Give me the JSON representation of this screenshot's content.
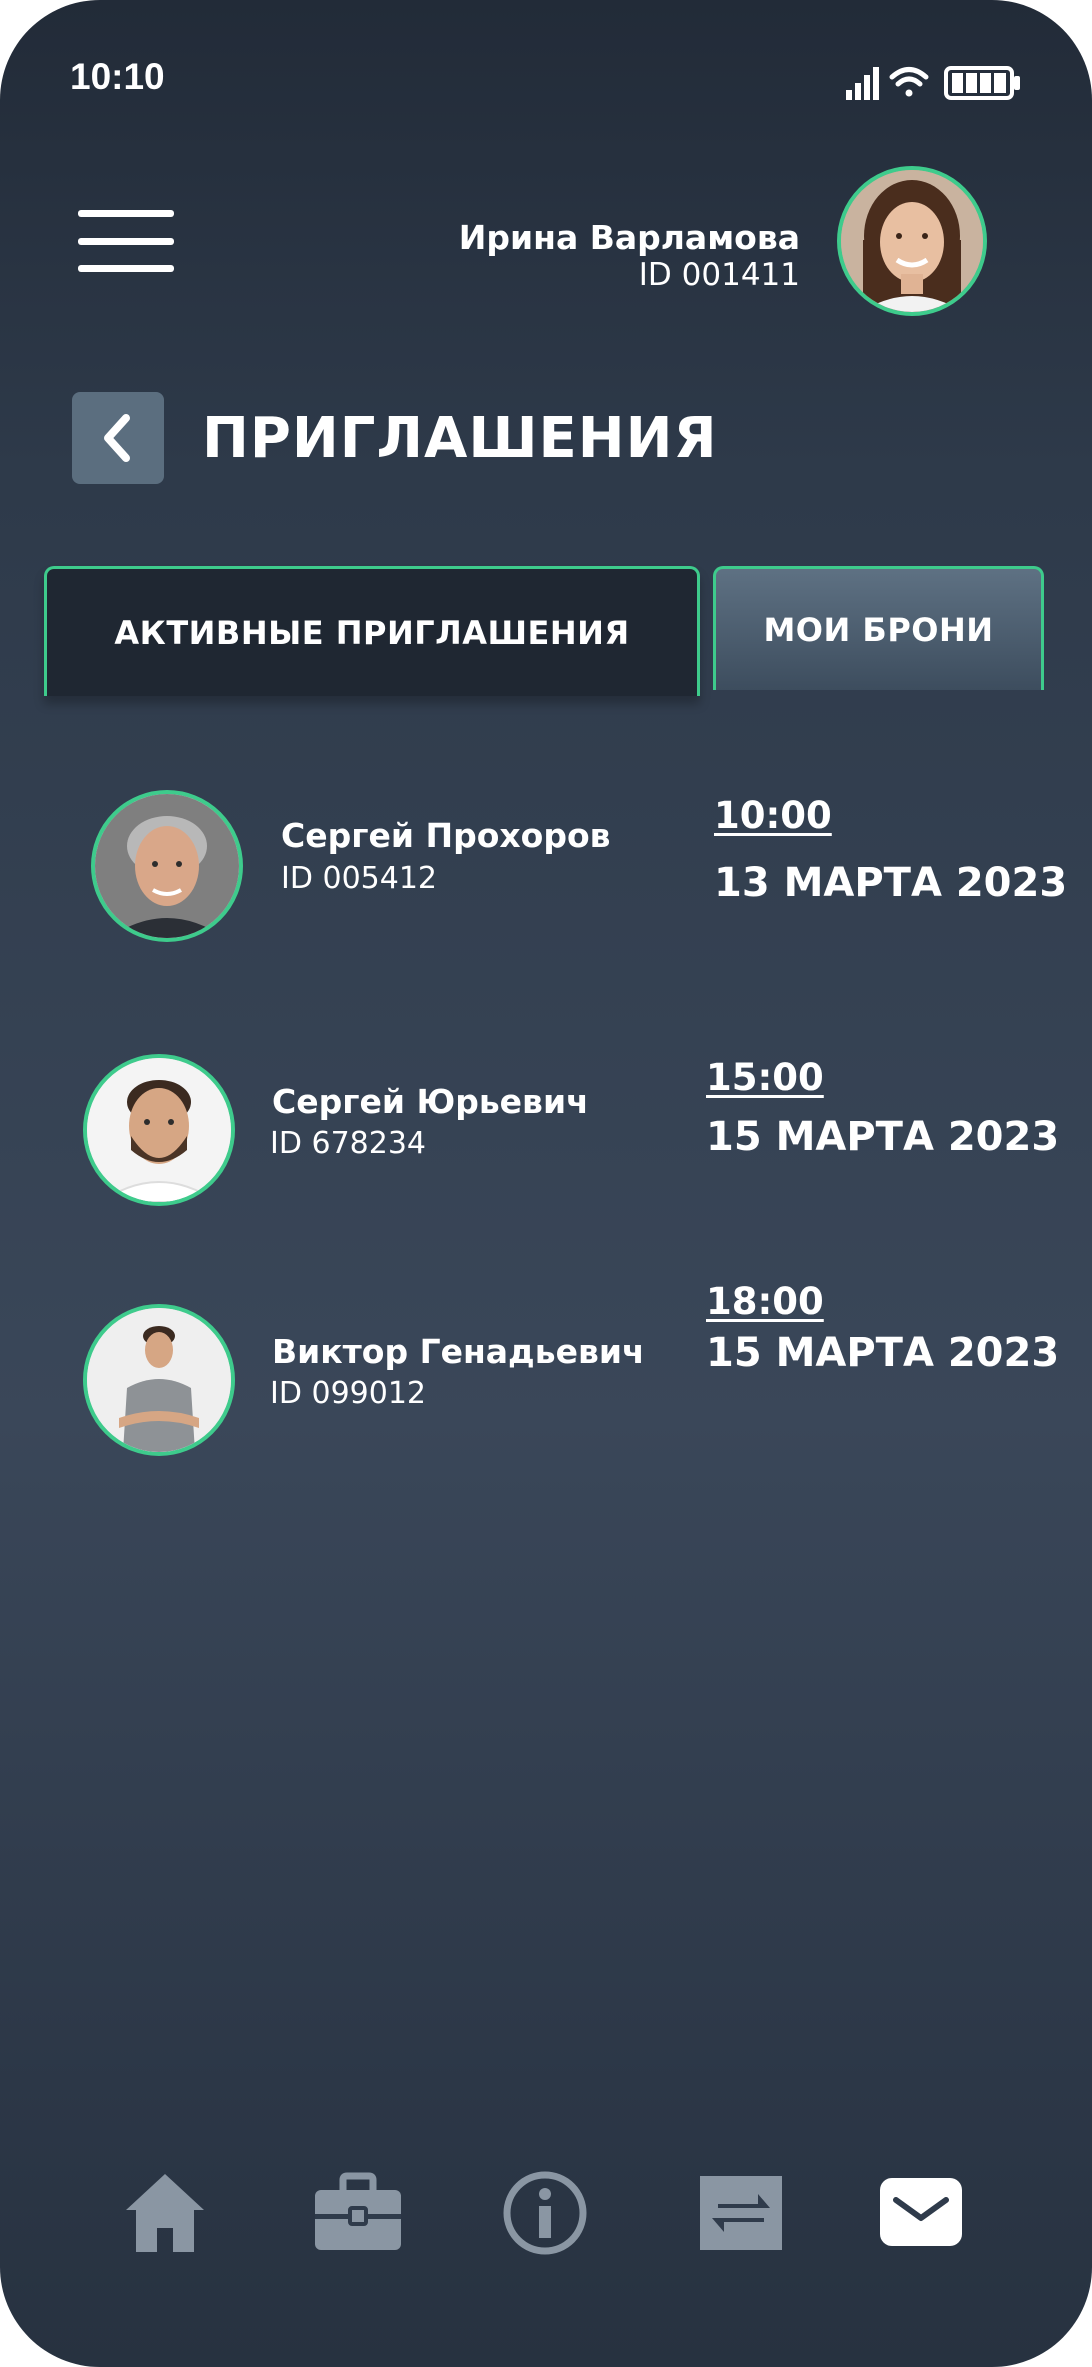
{
  "status_bar": {
    "time": "10:10",
    "icons": [
      "signal-icon",
      "wifi-icon",
      "battery-icon"
    ]
  },
  "header": {
    "user_name": "Ирина Варламова",
    "user_id": "ID 001411"
  },
  "page": {
    "title": "ПРИГЛАШЕНИЯ"
  },
  "tabs": [
    {
      "label": "АКТИВНЫЕ ПРИГЛАШЕНИЯ",
      "active": true
    },
    {
      "label": "МОИ БРОНИ",
      "active": false
    }
  ],
  "invitations": [
    {
      "name": "Сергей Прохоров",
      "id": "ID 005412",
      "time": "10:00",
      "date": "13 МАРТА 2023"
    },
    {
      "name": "Сергей Юрьевич",
      "id": "ID 678234",
      "time": "15:00",
      "date": "15 МАРТА 2023"
    },
    {
      "name": "Виктор Генадьевич",
      "id": "ID 099012",
      "time": "18:00",
      "date": "15 МАРТА 2023"
    }
  ],
  "bottom_nav": [
    {
      "icon": "home-icon"
    },
    {
      "icon": "briefcase-icon"
    },
    {
      "icon": "info-icon"
    },
    {
      "icon": "exchange-icon"
    },
    {
      "icon": "mail-icon",
      "active": true
    }
  ],
  "colors": {
    "accent": "#3ecb8c",
    "background_top": "#222b38",
    "background_mid": "#3a4759",
    "nav_icon": "#8a96a3",
    "nav_icon_active": "#ffffff"
  }
}
